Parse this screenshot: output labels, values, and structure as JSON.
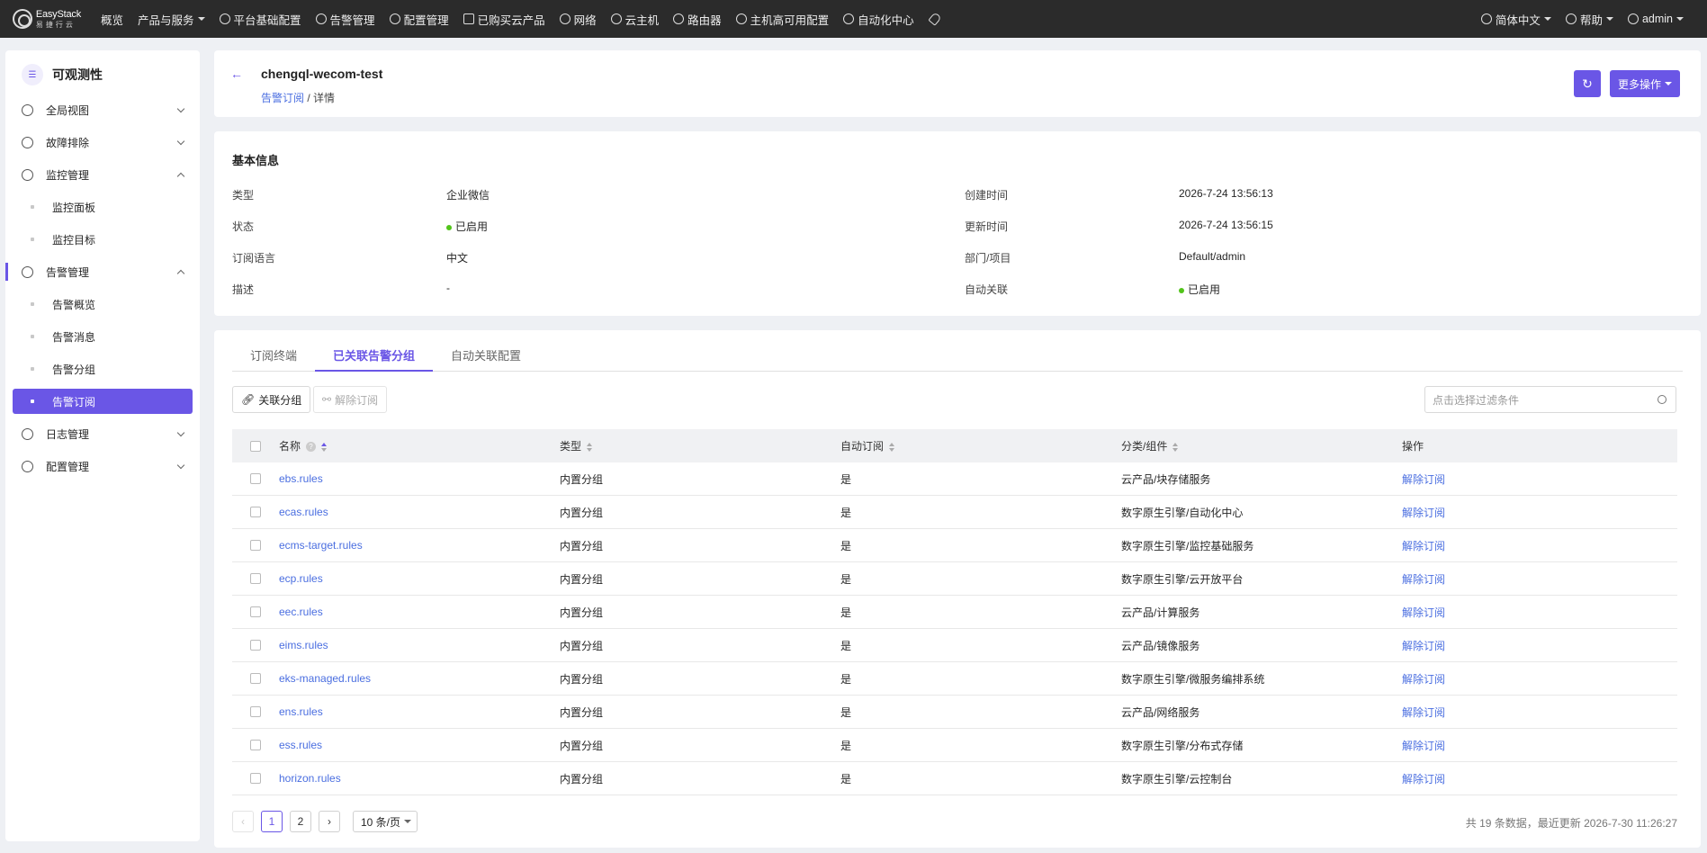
{
  "topbar": {
    "logo_line1": "EasyStack",
    "logo_line2": "易捷行云",
    "nav": [
      {
        "label": "概览",
        "icon": "none",
        "caret": false
      },
      {
        "label": "产品与服务",
        "icon": "none",
        "caret": true
      },
      {
        "label": "平台基础配置",
        "icon": "platform-icon",
        "caret": false
      },
      {
        "label": "告警管理",
        "icon": "alarm-icon",
        "caret": false
      },
      {
        "label": "配置管理",
        "icon": "gear-icon",
        "caret": false
      },
      {
        "label": "已购买云产品",
        "icon": "document-icon",
        "caret": false
      },
      {
        "label": "网络",
        "icon": "network-icon",
        "caret": false
      },
      {
        "label": "云主机",
        "icon": "cloud-icon",
        "caret": false
      },
      {
        "label": "路由器",
        "icon": "router-icon",
        "caret": false
      },
      {
        "label": "主机高可用配置",
        "icon": "host-icon",
        "caret": false
      },
      {
        "label": "自动化中心",
        "icon": "automation-icon",
        "caret": false
      }
    ],
    "language": "简体中文",
    "help": "帮助",
    "user": "admin"
  },
  "sidebar": {
    "title": "可观测性",
    "items": [
      {
        "label": "全局视图",
        "kind": "group",
        "expanded": false
      },
      {
        "label": "故障排除",
        "kind": "group",
        "expanded": false
      },
      {
        "label": "监控管理",
        "kind": "group",
        "expanded": true
      },
      {
        "label": "监控面板",
        "kind": "sub"
      },
      {
        "label": "监控目标",
        "kind": "sub"
      },
      {
        "label": "告警管理",
        "kind": "group",
        "expanded": true
      },
      {
        "label": "告警概览",
        "kind": "sub"
      },
      {
        "label": "告警消息",
        "kind": "sub"
      },
      {
        "label": "告警分组",
        "kind": "sub"
      },
      {
        "label": "告警订阅",
        "kind": "sub",
        "active": true
      },
      {
        "label": "日志管理",
        "kind": "group",
        "expanded": false
      },
      {
        "label": "配置管理",
        "kind": "group",
        "expanded": false
      }
    ]
  },
  "header": {
    "title": "chengql-wecom-test",
    "crumb_link": "告警订阅",
    "crumb_sep": " / ",
    "crumb_current": "详情",
    "more_label": "更多操作"
  },
  "info": {
    "title": "基本信息",
    "left": [
      {
        "label": "类型",
        "value": "企业微信",
        "dot": false
      },
      {
        "label": "状态",
        "value": "已启用",
        "dot": true
      },
      {
        "label": "订阅语言",
        "value": "中文",
        "dot": false
      },
      {
        "label": "描述",
        "value": "-",
        "dot": false
      }
    ],
    "right": [
      {
        "label": "创建时间",
        "value": "2026-7-24 13:56:13",
        "dot": false
      },
      {
        "label": "更新时间",
        "value": "2026-7-24 13:56:15",
        "dot": false
      },
      {
        "label": "部门/项目",
        "value": "Default/admin",
        "dot": false
      },
      {
        "label": "自动关联",
        "value": "已启用",
        "dot": true
      }
    ],
    "status_color": "#52c41a"
  },
  "tabs": [
    "订阅终端",
    "已关联告警分组",
    "自动关联配置"
  ],
  "active_tab": 1,
  "toolbar": {
    "link_label": "关联分组",
    "unlink_label": "解除订阅",
    "search_placeholder": "点击选择过滤条件"
  },
  "table": {
    "headers": [
      "名称",
      "类型",
      "自动订阅",
      "分类/组件",
      "操作"
    ],
    "rows": [
      [
        "ebs.rules",
        "内置分组",
        "是",
        "云产品/块存储服务",
        "解除订阅"
      ],
      [
        "ecas.rules",
        "内置分组",
        "是",
        "数字原生引擎/自动化中心",
        "解除订阅"
      ],
      [
        "ecms-target.rules",
        "内置分组",
        "是",
        "数字原生引擎/监控基础服务",
        "解除订阅"
      ],
      [
        "ecp.rules",
        "内置分组",
        "是",
        "数字原生引擎/云开放平台",
        "解除订阅"
      ],
      [
        "eec.rules",
        "内置分组",
        "是",
        "云产品/计算服务",
        "解除订阅"
      ],
      [
        "eims.rules",
        "内置分组",
        "是",
        "云产品/镜像服务",
        "解除订阅"
      ],
      [
        "eks-managed.rules",
        "内置分组",
        "是",
        "数字原生引擎/微服务编排系统",
        "解除订阅"
      ],
      [
        "ens.rules",
        "内置分组",
        "是",
        "云产品/网络服务",
        "解除订阅"
      ],
      [
        "ess.rules",
        "内置分组",
        "是",
        "数字原生引擎/分布式存储",
        "解除订阅"
      ],
      [
        "horizon.rules",
        "内置分组",
        "是",
        "数字原生引擎/云控制台",
        "解除订阅"
      ]
    ]
  },
  "pager": {
    "pages": [
      "1",
      "2"
    ],
    "current": "1",
    "page_size": "10 条/页",
    "status": "共 19 条数据，最近更新  2026-7-30 11:26:27"
  },
  "accent": "#6a56e6",
  "link_color": "#4a6ee0"
}
